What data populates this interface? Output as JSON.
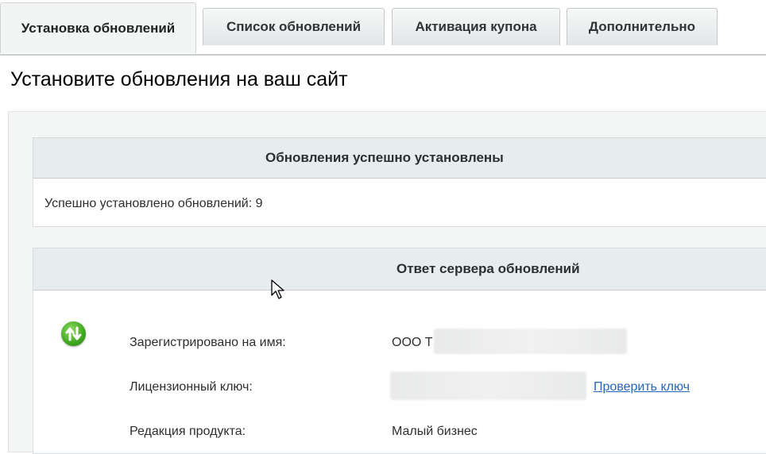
{
  "tabs": [
    {
      "label": "Установка обновлений",
      "active": true
    },
    {
      "label": "Список обновлений",
      "active": false
    },
    {
      "label": "Активация купона",
      "active": false
    },
    {
      "label": "Дополнительно",
      "active": false
    }
  ],
  "page": {
    "title": "Установите обновления на ваш сайт"
  },
  "result_panel": {
    "header": "Обновления успешно установлены",
    "message": "Успешно установлено обновлений: 9"
  },
  "server_panel": {
    "header": "Ответ сервера обновлений",
    "icon": "update-arrows-icon",
    "rows": [
      {
        "label": "Зарегистрировано на имя:",
        "value": "ООО Т"
      },
      {
        "label": "Лицензионный ключ:",
        "value": "",
        "link": "Проверить ключ"
      },
      {
        "label": "Редакция продукта:",
        "value": "Малый бизнес"
      }
    ]
  },
  "colors": {
    "accent_link": "#2766b8",
    "icon_green": "#3fa71f",
    "header_bg": "#e7ecee"
  }
}
